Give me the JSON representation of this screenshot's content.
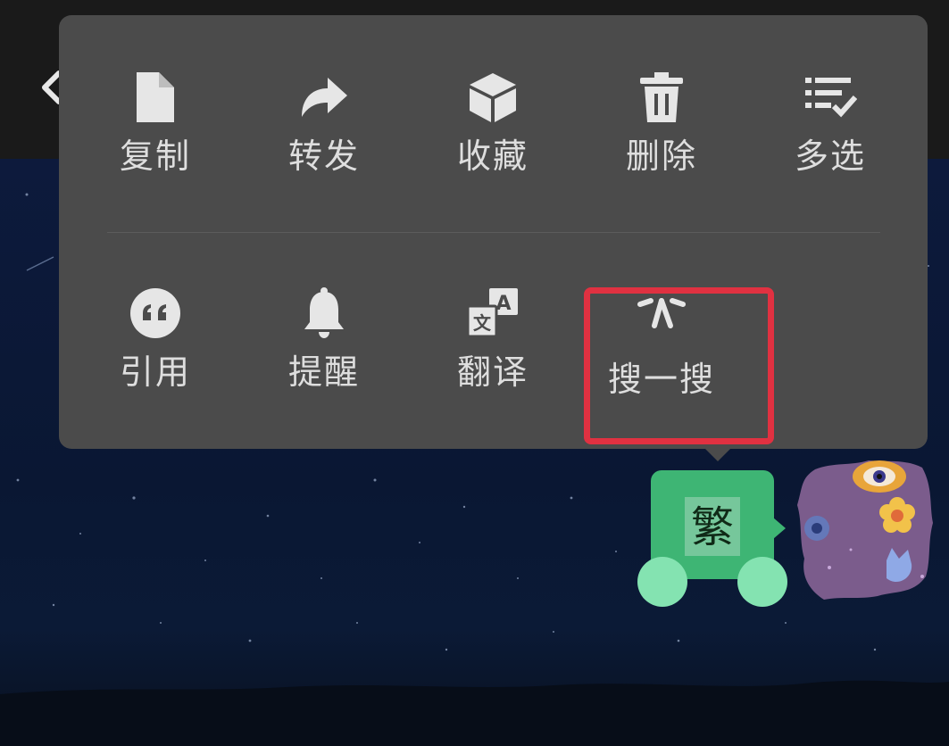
{
  "menu": {
    "row1": [
      {
        "label": "复制",
        "icon": "document-icon"
      },
      {
        "label": "转发",
        "icon": "forward-arrow-icon"
      },
      {
        "label": "收藏",
        "icon": "cube-icon"
      },
      {
        "label": "删除",
        "icon": "trash-icon"
      },
      {
        "label": "多选",
        "icon": "multi-select-icon"
      }
    ],
    "row2": [
      {
        "label": "引用",
        "icon": "quote-icon"
      },
      {
        "label": "提醒",
        "icon": "bell-icon"
      },
      {
        "label": "翻译",
        "icon": "translate-icon"
      },
      {
        "label": "搜一搜",
        "icon": "search-sparkle-icon"
      }
    ]
  },
  "chat": {
    "message_text": "繁"
  },
  "colors": {
    "menu_bg": "#4b4b4b",
    "highlight": "#e03141",
    "bubble": "#3eb574",
    "selection_handle": "#84e3b1"
  }
}
